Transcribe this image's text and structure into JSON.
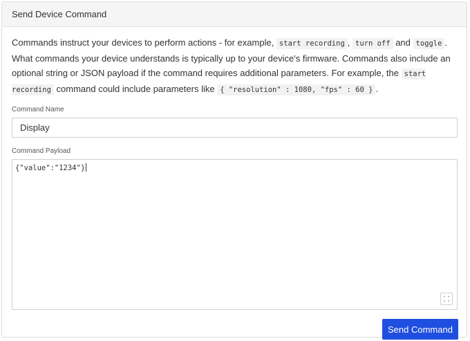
{
  "panel": {
    "title": "Send Device Command",
    "description": {
      "part1": "Commands instruct your devices to perform actions - for example, ",
      "code1": "start recording",
      "sep1": ", ",
      "code2": "turn off",
      "part2": " and ",
      "code3": "toggle",
      "part3": ". What commands your device understands is typically up to your device's firmware. Commands also include an optional string or JSON payload if the command requires additional parameters. For example, the ",
      "code4": "start recording",
      "part4": " command could include parameters like ",
      "code5": "{ \"resolution\" : 1080, \"fps\" : 60 }",
      "part5": "."
    }
  },
  "command_name": {
    "label": "Command Name",
    "value": "Display"
  },
  "command_payload": {
    "label": "Command Payload",
    "value": "{\"value\":\"1234\"}"
  },
  "footer": {
    "send_label": "Send Command"
  },
  "colors": {
    "accent": "#1f4fe0",
    "header_bg": "#f5f5f5",
    "border": "#cfcfcf"
  },
  "icons": {
    "resize": "expand-icon"
  }
}
